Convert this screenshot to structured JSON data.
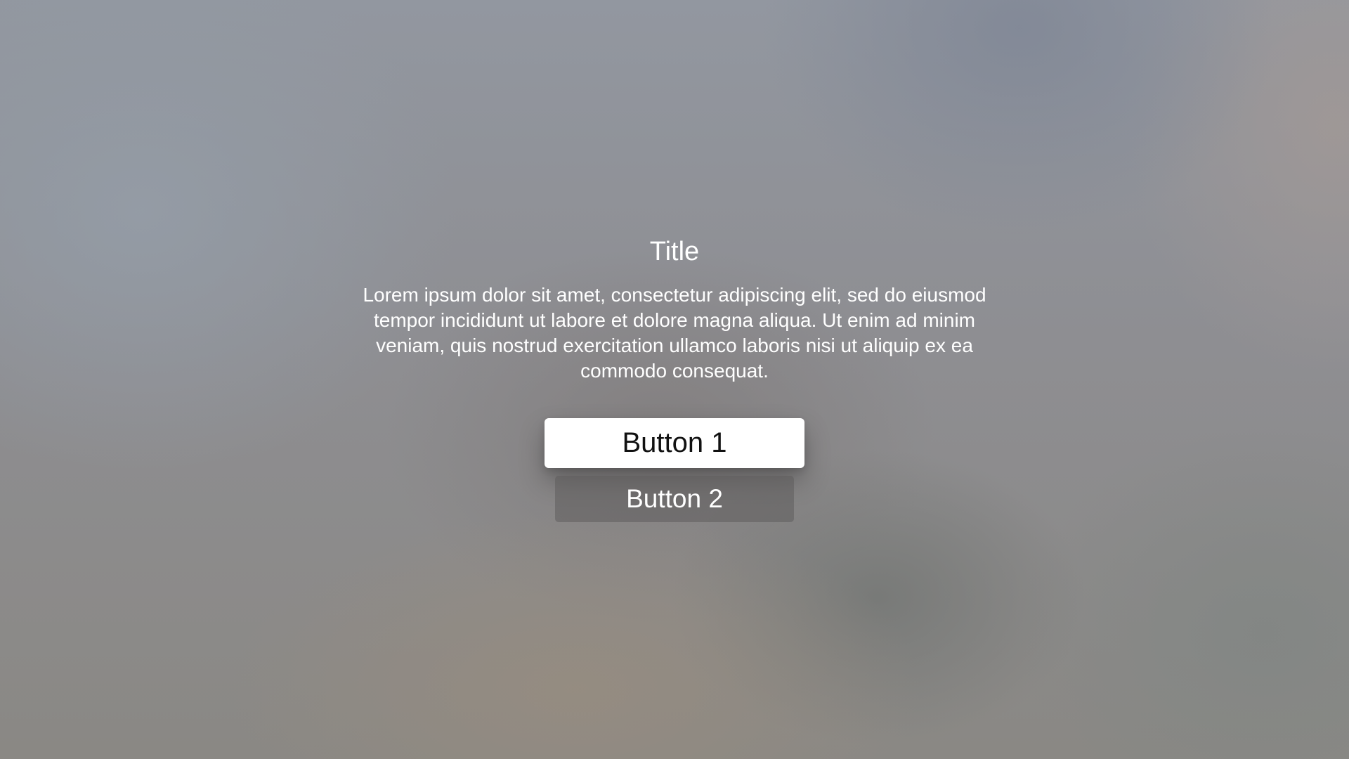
{
  "alert": {
    "title": "Title",
    "message": "Lorem ipsum dolor sit amet, consectetur adipiscing elit, sed do eiusmod tempor incididunt ut labore et dolore magna aliqua. Ut enim ad minim veniam, quis nostrud exercitation ullamco laboris nisi ut aliquip ex ea commodo consequat.",
    "buttons": [
      {
        "label": "Button 1",
        "focused": true
      },
      {
        "label": "Button 2",
        "focused": false
      }
    ]
  },
  "colors": {
    "focused_button_bg": "#ffffff",
    "focused_button_text": "#111111",
    "unfocused_button_text": "#ffffff",
    "text": "#ffffff"
  }
}
